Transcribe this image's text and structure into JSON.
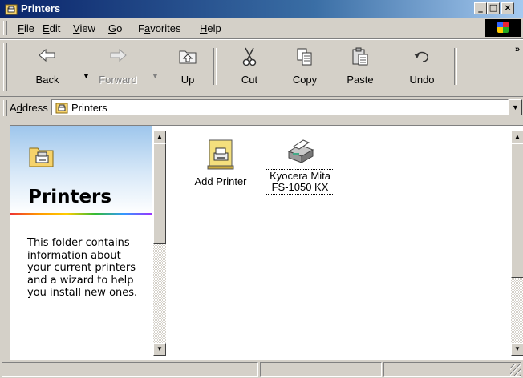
{
  "window": {
    "title": "Printers",
    "icon": "printer-folder-icon",
    "title_bar_color": "#0a246a"
  },
  "menu": {
    "items": [
      {
        "label": "File",
        "accel": "F",
        "rest": "ile"
      },
      {
        "label": "Edit",
        "accel": "E",
        "rest": "dit"
      },
      {
        "label": "View",
        "accel": "V",
        "rest": "iew"
      },
      {
        "label": "Go",
        "accel": "G",
        "rest": "o"
      },
      {
        "label": "Favorites",
        "pre": "F",
        "accel": "a",
        "rest": "vorites"
      },
      {
        "label": "Help",
        "accel": "H",
        "rest": "elp"
      }
    ]
  },
  "toolbar": {
    "back": "Back",
    "forward": "Forward",
    "up": "Up",
    "cut": "Cut",
    "copy": "Copy",
    "paste": "Paste",
    "undo": "Undo",
    "chevron": "»"
  },
  "address": {
    "label_pre": "A",
    "label_accel": "d",
    "label_rest": "dress",
    "value": "Printers"
  },
  "left_pane": {
    "title": "Printers",
    "description": "This folder contains information about your current printers and a wizard to help you install new ones."
  },
  "items": [
    {
      "label": "Add Printer",
      "icon": "add-printer-icon"
    },
    {
      "label_line1": "Kyocera Mita",
      "label_line2": "FS-1050 KX",
      "icon": "printer-icon"
    }
  ]
}
